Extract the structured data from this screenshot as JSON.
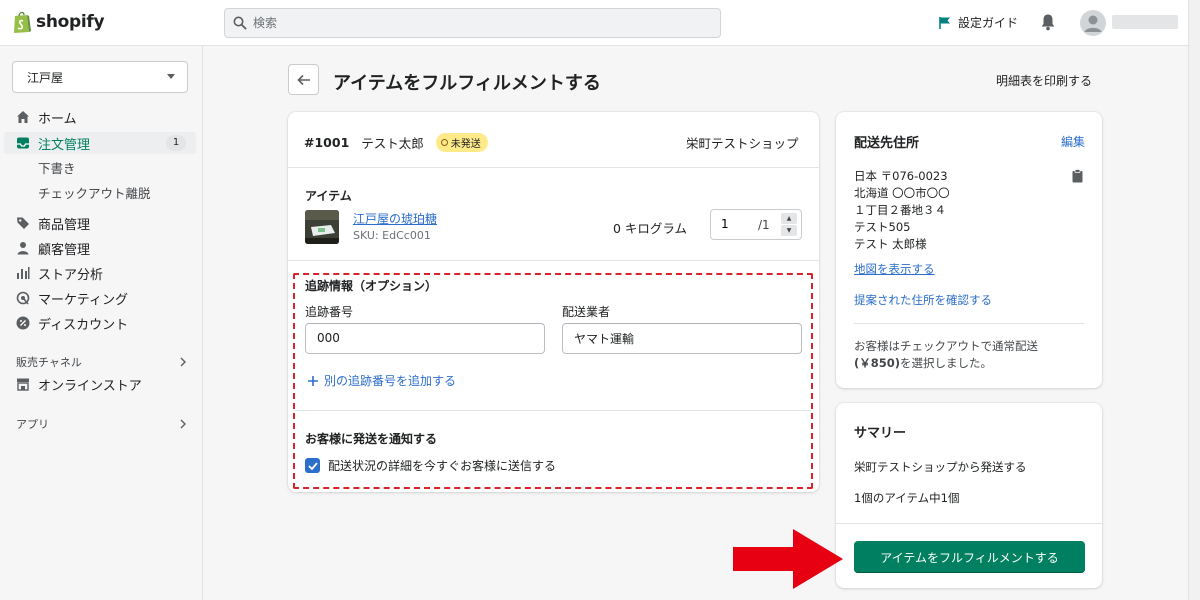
{
  "topbar": {
    "logo_text": "shopify",
    "search_placeholder": "検索",
    "guide_label": "設定ガイド"
  },
  "sidebar": {
    "store_name": "江戸屋",
    "items": [
      {
        "label": "ホーム"
      },
      {
        "label": "注文管理",
        "count": "1"
      },
      {
        "label": "下書き"
      },
      {
        "label": "チェックアウト離脱"
      },
      {
        "label": "商品管理"
      },
      {
        "label": "顧客管理"
      },
      {
        "label": "ストア分析"
      },
      {
        "label": "マーケティング"
      },
      {
        "label": "ディスカウント"
      }
    ],
    "sales_channels_label": "販売チャネル",
    "online_store_label": "オンラインストア",
    "apps_label": "アプリ"
  },
  "page": {
    "title": "アイテムをフルフィルメントする",
    "print_label": "明細表を印刷する"
  },
  "order": {
    "number": "#1001",
    "customer": "テスト太郎",
    "status": "未発送",
    "location": "栄町テストショップ",
    "items_label": "アイテム",
    "item": {
      "name": "江戸屋の琥珀糖",
      "sku": "SKU: EdCc001",
      "weight": "0 キログラム",
      "quantity": "1",
      "of_total": "/1"
    }
  },
  "tracking": {
    "title": "追跡情報（オプション）",
    "number_label": "追跡番号",
    "number_value": "000",
    "carrier_label": "配送業者",
    "carrier_value": "ヤマト運輸",
    "add_label": "別の追跡番号を追加する",
    "notify_title": "お客様に発送を通知する",
    "notify_checkbox_label": "配送状況の詳細を今すぐお客様に送信する"
  },
  "shipping": {
    "title": "配送先住所",
    "edit_label": "編集",
    "address_lines": [
      "日本 〒076-0023",
      "北海道 〇〇市〇〇",
      "１丁目２番地３４",
      "テスト505",
      "テスト 太郎様"
    ],
    "map_link": "地図を表示する",
    "suggested_link": "提案された住所を確認する",
    "note_line1": "お客様はチェックアウトで通常配送",
    "note_price": "(￥850)",
    "note_line2": "を選択しました。"
  },
  "summary": {
    "title": "サマリー",
    "from": "栄町テストショップから発送する",
    "count": "1個のアイテム中1個",
    "button_label": "アイテムをフルフィルメントする"
  },
  "colors": {
    "primary_green": "#008060",
    "link_blue": "#2c6ecb",
    "highlight_red": "#d8232a",
    "status_yellow": "#ffea8a"
  }
}
